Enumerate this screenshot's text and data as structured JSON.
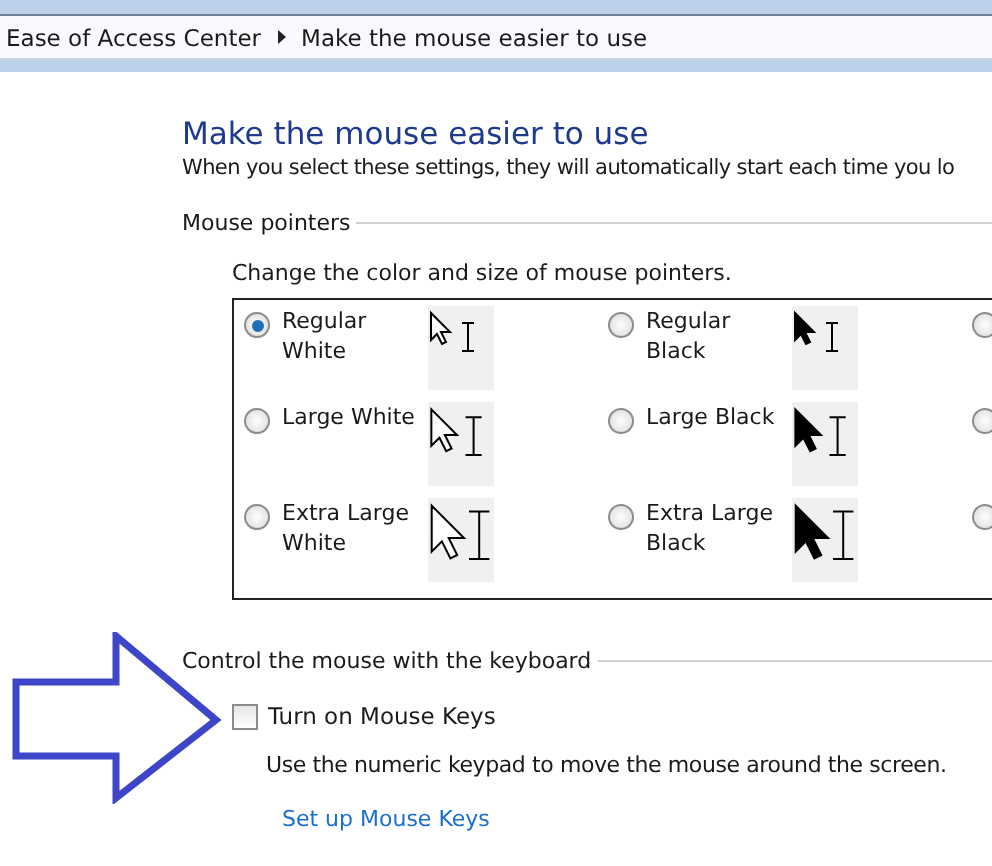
{
  "breadcrumb": [
    {
      "label": "Ease of Access Center"
    },
    {
      "label": "Make the mouse easier to use"
    }
  ],
  "title": "Make the mouse easier to use",
  "description": "When you select these settings, they will automatically start each time you lo",
  "mouse_pointers": {
    "heading": "Mouse pointers",
    "hint": "Change the color and size of mouse pointers.",
    "options": [
      {
        "label": "Regular White",
        "kind": "white",
        "selected": true
      },
      {
        "label": "Regular Black",
        "kind": "black",
        "selected": false
      },
      {
        "selected": false
      },
      {
        "label": "Large White",
        "kind": "white",
        "selected": false
      },
      {
        "label": "Large Black",
        "kind": "black",
        "selected": false
      },
      {
        "selected": false
      },
      {
        "label": "Extra Large White",
        "kind": "white",
        "selected": false
      },
      {
        "label": "Extra Large Black",
        "kind": "black",
        "selected": false
      },
      {
        "selected": false
      }
    ]
  },
  "keyboard": {
    "heading": "Control the mouse with the keyboard",
    "checkbox": {
      "label": "Turn on Mouse Keys",
      "checked": false
    },
    "note": "Use the numeric keypad to move the mouse around the screen.",
    "link": "Set up Mouse Keys"
  },
  "annotation": {
    "arrow": true
  }
}
